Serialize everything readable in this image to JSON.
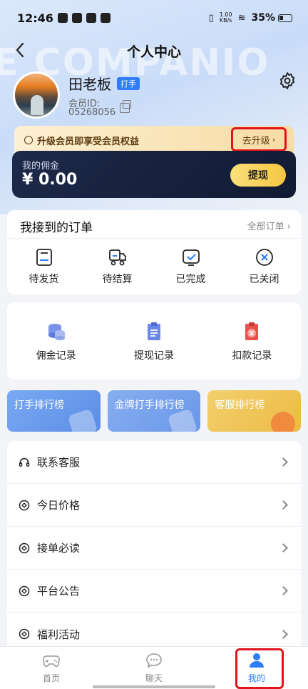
{
  "status_bar": {
    "time": "12:46",
    "speed": "1.00",
    "speed_unit": "KB/s",
    "battery": "35%"
  },
  "header": {
    "title": "个人中心",
    "back_icon": "back-arrow-icon",
    "watermark": "E COMPANIO"
  },
  "profile": {
    "name": "田老板",
    "role_badge": "打手",
    "member_id_label": "会员ID:",
    "member_id": "05268056"
  },
  "upgrade": {
    "text": "升级会员即享受会员权益",
    "button": "去升级"
  },
  "commission": {
    "label": "我的佣金",
    "value": "¥ 0.00",
    "withdraw": "提现"
  },
  "orders": {
    "title": "我接到的订单",
    "all": "全部订单",
    "items": [
      {
        "label": "待发货",
        "icon": "pending-ship-icon"
      },
      {
        "label": "待结算",
        "icon": "pending-settle-icon"
      },
      {
        "label": "已完成",
        "icon": "completed-icon"
      },
      {
        "label": "已关闭",
        "icon": "closed-icon"
      }
    ]
  },
  "records": [
    {
      "label": "佣金记录",
      "icon": "coins-icon"
    },
    {
      "label": "提现记录",
      "icon": "document-icon"
    },
    {
      "label": "扣款记录",
      "icon": "deduct-icon"
    }
  ],
  "rankings": [
    {
      "label": "打手排行榜"
    },
    {
      "label": "金牌打手排行榜"
    },
    {
      "label": "客服排行榜"
    }
  ],
  "menu": [
    {
      "label": "联系客服",
      "icon": "headset-icon"
    },
    {
      "label": "今日价格",
      "icon": "circle-dot-icon"
    },
    {
      "label": "接单必读",
      "icon": "circle-dot-icon"
    },
    {
      "label": "平台公告",
      "icon": "circle-dot-icon"
    },
    {
      "label": "福利活动",
      "icon": "circle-dot-icon"
    }
  ],
  "tabs": [
    {
      "label": "首页",
      "icon": "gamepad-icon"
    },
    {
      "label": "聊天",
      "icon": "chat-icon"
    },
    {
      "label": "我的",
      "icon": "user-icon"
    }
  ],
  "colors": {
    "accent": "#2e7cf6",
    "highlight": "#e0141c",
    "card_dark": "#1a2442"
  }
}
